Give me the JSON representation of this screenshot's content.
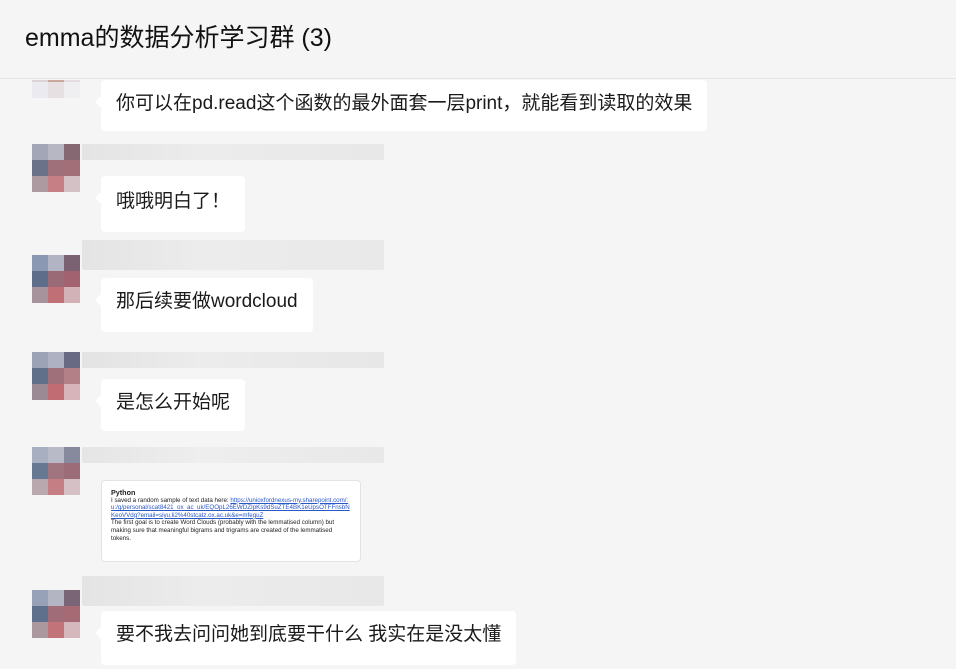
{
  "header": {
    "title": "emma的数据分析学习群 (3)"
  },
  "messages": [
    {
      "text": "你可以在pd.read这个函数的最外面套一层print，就能看到读取的效果"
    },
    {
      "text": "哦哦明白了！"
    },
    {
      "text": "那后续要做wordcloud"
    },
    {
      "text": "是怎么开始呢"
    },
    {
      "type": "image",
      "heading": "Python",
      "line1": "I saved a random sample of text data here:",
      "link": "https://unioxfordnexus-my.sharepoint.com/:u:/g/personal/scat8421_ox_ac_uk/EQOpL26EWDZIpKs9dSuZTE4BK1eUpsOTFFnsbNKeoVVdg?email=siyu.li2%40stcatz.ox.ac.uk&e=mfeguZ",
      "line2": "The first goal is to create Word Clouds (probably with the lemmatised column) but making sure that meaningful bigrams and trigrams are created of the lemmatised tokens."
    },
    {
      "text": "要不我去问问她到底要干什么 我实在是没太懂"
    }
  ],
  "colors": {
    "background": "#f5f5f5",
    "bubble": "#ffffff",
    "text": "#1a1a1a",
    "link": "#2a57c7"
  },
  "icons": {
    "avatar": "pixelated-avatar-icon"
  }
}
